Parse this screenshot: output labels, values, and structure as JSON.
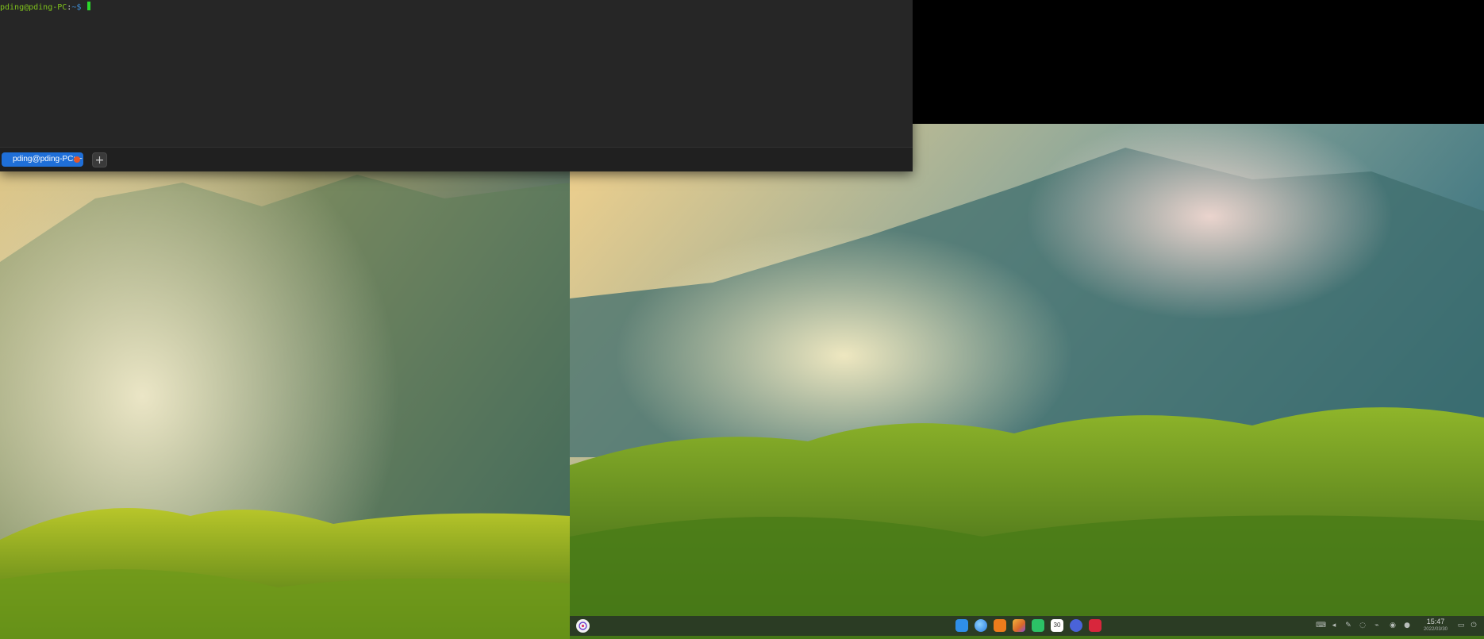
{
  "terminal": {
    "prompt_user": "pding@pding-PC",
    "prompt_sep": ":",
    "prompt_path": "~$",
    "tab_label": "pding@pding-PC: ~",
    "new_tab_symbol": "+"
  },
  "dock": {
    "apps": [
      {
        "name": "file-manager-icon",
        "color": "#2f8fe8"
      },
      {
        "name": "browser-icon",
        "color": "#2a7de1"
      },
      {
        "name": "app-store-icon",
        "color": "#ee7c1c"
      },
      {
        "name": "image-viewer-icon",
        "color": "#d9682a"
      },
      {
        "name": "music-icon",
        "color": "#2cc266"
      },
      {
        "name": "calendar-icon",
        "color": "#ffffff"
      },
      {
        "name": "settings-icon",
        "color": "#4a63d8"
      },
      {
        "name": "terminal-icon",
        "color": "#d8263c"
      }
    ],
    "calendar_day": "30",
    "clock_time": "15:47",
    "clock_date": "2022/03/30"
  }
}
